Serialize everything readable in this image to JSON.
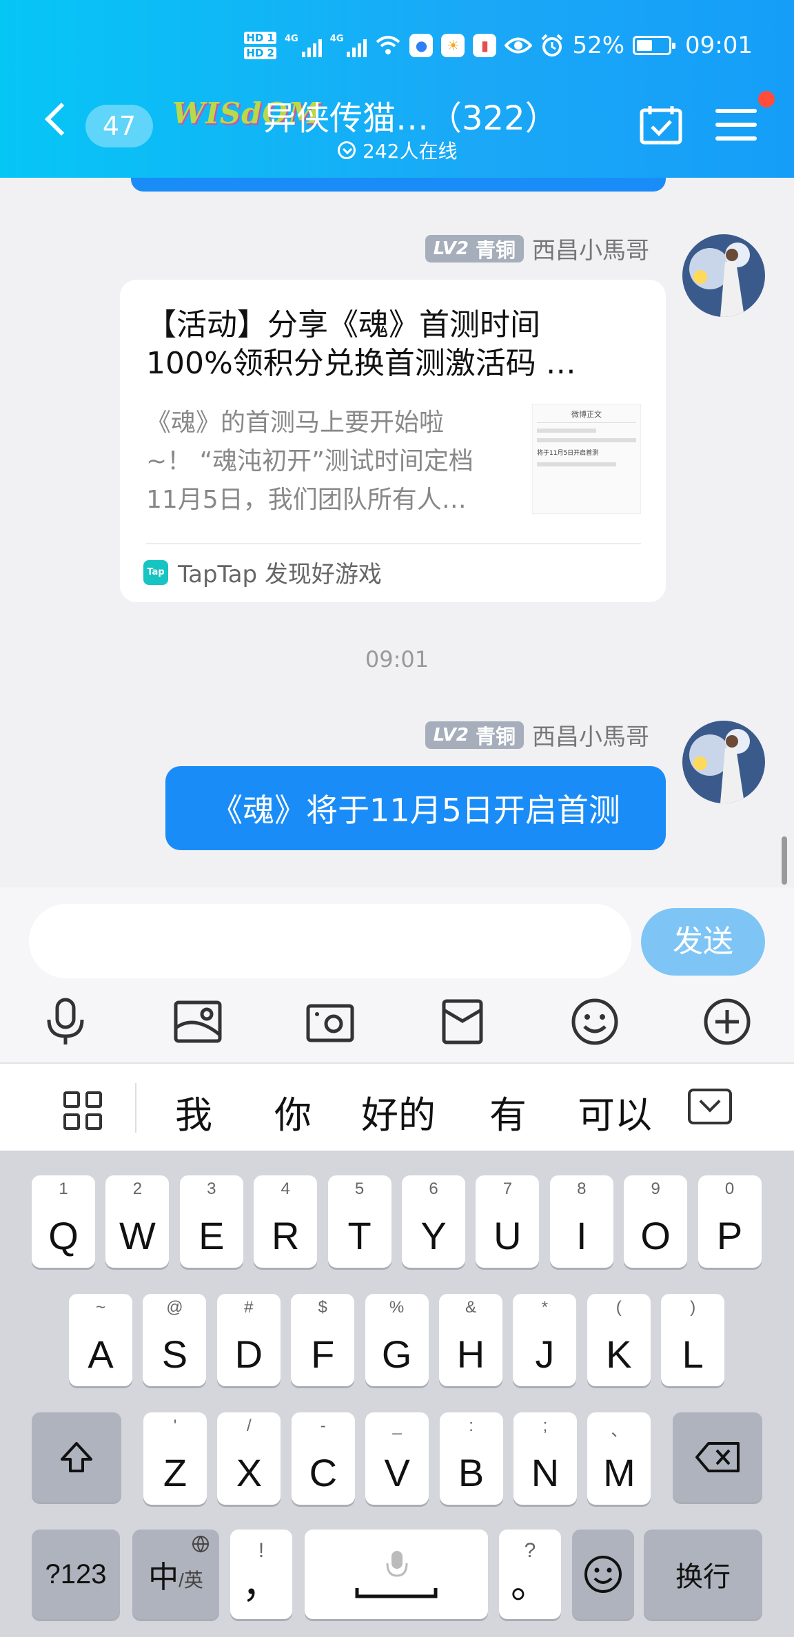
{
  "status_bar": {
    "network": "4G",
    "battery": "52%",
    "time": "09:01"
  },
  "header": {
    "unread_count": "47",
    "logo_text": "WISdOM",
    "group_title": "异侠传猫…（322）",
    "online_text": "242人在线"
  },
  "messages": [
    {
      "level": "LV2",
      "rank": "青铜",
      "sender": "西昌小馬哥",
      "card": {
        "title_line1": "【活动】分享《魂》首测时间",
        "title_line2": "100%领积分兑换首测激活码 …",
        "desc_line1": "《魂》的首测马上要开始啦",
        "desc_line2": "~！ “魂沌初开”测试时间定档",
        "desc_line3": "11月5日，我们团队所有人…",
        "thumb_title": "微博正文",
        "thumb_text": "将于11月5日开启首测",
        "source": "TapTap 发现好游戏",
        "source_icon": "Tap"
      }
    },
    {
      "timestamp": "09:01",
      "level": "LV2",
      "rank": "青铜",
      "sender": "西昌小馬哥",
      "text": "《魂》将于11月5日开启首测"
    }
  ],
  "input": {
    "placeholder": "",
    "send_label": "发送"
  },
  "toolbar": [
    "voice-icon",
    "image-icon",
    "camera-icon",
    "red-packet-icon",
    "emoji-icon",
    "plus-icon"
  ],
  "keyboard": {
    "suggestions": [
      "我",
      "你",
      "好的",
      "有",
      "可以"
    ],
    "row1": [
      {
        "c": "Q",
        "s": "1"
      },
      {
        "c": "W",
        "s": "2"
      },
      {
        "c": "E",
        "s": "3"
      },
      {
        "c": "R",
        "s": "4"
      },
      {
        "c": "T",
        "s": "5"
      },
      {
        "c": "Y",
        "s": "6"
      },
      {
        "c": "U",
        "s": "7"
      },
      {
        "c": "I",
        "s": "8"
      },
      {
        "c": "O",
        "s": "9"
      },
      {
        "c": "P",
        "s": "0"
      }
    ],
    "row2": [
      {
        "c": "A",
        "s": "~"
      },
      {
        "c": "S",
        "s": "@"
      },
      {
        "c": "D",
        "s": "#"
      },
      {
        "c": "F",
        "s": "$"
      },
      {
        "c": "G",
        "s": "%"
      },
      {
        "c": "H",
        "s": "&"
      },
      {
        "c": "J",
        "s": "*"
      },
      {
        "c": "K",
        "s": "("
      },
      {
        "c": "L",
        "s": ")"
      }
    ],
    "row3": [
      {
        "c": "Z",
        "s": "'"
      },
      {
        "c": "X",
        "s": "/"
      },
      {
        "c": "C",
        "s": "-"
      },
      {
        "c": "V",
        "s": "_"
      },
      {
        "c": "B",
        "s": ":"
      },
      {
        "c": "N",
        "s": ";"
      },
      {
        "c": "M",
        "s": "、"
      }
    ],
    "num_label": "?123",
    "lang_main": "中",
    "lang_sub": "/英",
    "comma_top": "!",
    "comma": "，",
    "period_top": "?",
    "period": "。",
    "enter_label": "换行"
  },
  "colors": {
    "header_start": "#06c6f6",
    "header_end": "#159ef8",
    "bubble": "#1a8cf7",
    "send_button": "#7ec5f6",
    "notification_dot": "#ff4d3a"
  }
}
